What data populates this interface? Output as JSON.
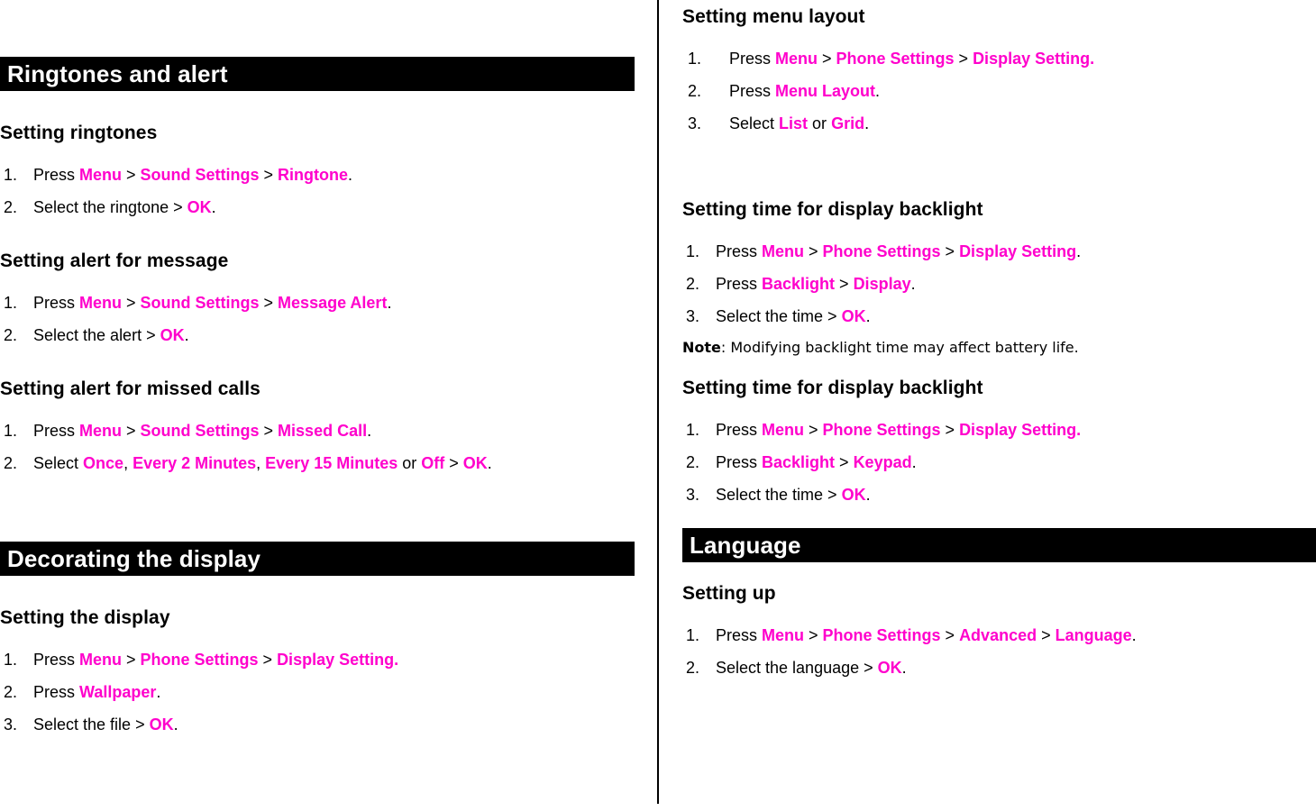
{
  "theme": {
    "accent_magenta": "#ff00cc",
    "banner_background": "#000000",
    "banner_text": "#ffffff",
    "page_background": "#ffffff",
    "body_text": "#000000"
  },
  "left_column": {
    "sections": [
      {
        "banner": "Ringtones and alert",
        "topics": [
          {
            "heading": "Setting ringtones",
            "steps": [
              {
                "num": "1.",
                "parts": [
                  {
                    "t": "Press ",
                    "k": "plain"
                  },
                  {
                    "t": "Menu",
                    "k": "mag"
                  },
                  {
                    "t": " > ",
                    "k": "plain"
                  },
                  {
                    "t": "Sound Settings",
                    "k": "mag"
                  },
                  {
                    "t": " > ",
                    "k": "plain"
                  },
                  {
                    "t": "Ringtone",
                    "k": "mag"
                  },
                  {
                    "t": ".",
                    "k": "plain"
                  }
                ]
              },
              {
                "num": "2.",
                "parts": [
                  {
                    "t": "Select the ringtone > ",
                    "k": "plain"
                  },
                  {
                    "t": "OK",
                    "k": "mag"
                  },
                  {
                    "t": ".",
                    "k": "plain"
                  }
                ]
              }
            ]
          },
          {
            "heading": "Setting alert for message",
            "steps": [
              {
                "num": "1.",
                "parts": [
                  {
                    "t": "Press ",
                    "k": "plain"
                  },
                  {
                    "t": "Menu",
                    "k": "mag"
                  },
                  {
                    "t": " > ",
                    "k": "plain"
                  },
                  {
                    "t": "Sound Settings",
                    "k": "mag"
                  },
                  {
                    "t": " > ",
                    "k": "plain"
                  },
                  {
                    "t": "Message Alert",
                    "k": "mag"
                  },
                  {
                    "t": ".",
                    "k": "plain"
                  }
                ]
              },
              {
                "num": "2.",
                "parts": [
                  {
                    "t": "Select the alert > ",
                    "k": "plain"
                  },
                  {
                    "t": "OK",
                    "k": "mag"
                  },
                  {
                    "t": ".",
                    "k": "plain"
                  }
                ]
              }
            ]
          },
          {
            "heading": "Setting alert for missed calls",
            "steps": [
              {
                "num": "1.",
                "parts": [
                  {
                    "t": "Press ",
                    "k": "plain"
                  },
                  {
                    "t": "Menu",
                    "k": "mag"
                  },
                  {
                    "t": " > ",
                    "k": "plain"
                  },
                  {
                    "t": "Sound Settings",
                    "k": "mag"
                  },
                  {
                    "t": " > ",
                    "k": "plain"
                  },
                  {
                    "t": "Missed Call",
                    "k": "mag"
                  },
                  {
                    "t": ".",
                    "k": "plain"
                  }
                ]
              },
              {
                "num": "2.",
                "parts": [
                  {
                    "t": "Select ",
                    "k": "plain"
                  },
                  {
                    "t": "Once",
                    "k": "mag"
                  },
                  {
                    "t": ", ",
                    "k": "plain"
                  },
                  {
                    "t": "Every 2 Minutes",
                    "k": "mag"
                  },
                  {
                    "t": ", ",
                    "k": "plain"
                  },
                  {
                    "t": "Every 15 Minutes",
                    "k": "mag"
                  },
                  {
                    "t": " or ",
                    "k": "plain"
                  },
                  {
                    "t": "Off",
                    "k": "mag"
                  },
                  {
                    "t": " > ",
                    "k": "plain"
                  },
                  {
                    "t": "OK",
                    "k": "mag"
                  },
                  {
                    "t": ".",
                    "k": "plain"
                  }
                ]
              }
            ]
          }
        ]
      },
      {
        "banner": "Decorating the display",
        "topics": [
          {
            "heading": "Setting the display",
            "steps": [
              {
                "num": "1.",
                "parts": [
                  {
                    "t": "Press ",
                    "k": "plain"
                  },
                  {
                    "t": "Menu",
                    "k": "mag"
                  },
                  {
                    "t": " > ",
                    "k": "plain"
                  },
                  {
                    "t": "Phone Settings",
                    "k": "mag"
                  },
                  {
                    "t": " > ",
                    "k": "plain"
                  },
                  {
                    "t": "Display Setting.",
                    "k": "mag"
                  }
                ]
              },
              {
                "num": "2.",
                "parts": [
                  {
                    "t": "Press ",
                    "k": "plain"
                  },
                  {
                    "t": "Wallpaper",
                    "k": "mag"
                  },
                  {
                    "t": ".",
                    "k": "plain"
                  }
                ]
              },
              {
                "num": "3.",
                "parts": [
                  {
                    "t": "Select the file > ",
                    "k": "plain"
                  },
                  {
                    "t": "OK",
                    "k": "mag"
                  },
                  {
                    "t": ".",
                    "k": "plain"
                  }
                ]
              }
            ]
          }
        ]
      }
    ]
  },
  "right_column": {
    "topics": [
      {
        "heading": "Setting menu layout",
        "wide_numbers": true,
        "steps": [
          {
            "num": "1.",
            "parts": [
              {
                "t": "Press ",
                "k": "plain"
              },
              {
                "t": "Menu",
                "k": "mag"
              },
              {
                "t": " > ",
                "k": "plain"
              },
              {
                "t": "Phone Settings",
                "k": "mag"
              },
              {
                "t": " > ",
                "k": "plain"
              },
              {
                "t": "Display Setting.",
                "k": "mag"
              }
            ]
          },
          {
            "num": "2.",
            "parts": [
              {
                "t": "Press ",
                "k": "plain"
              },
              {
                "t": "Menu Layout",
                "k": "mag"
              },
              {
                "t": ".",
                "k": "plain"
              }
            ]
          },
          {
            "num": "3.",
            "parts": [
              {
                "t": "Select ",
                "k": "plain"
              },
              {
                "t": "List",
                "k": "mag"
              },
              {
                "t": " or ",
                "k": "plain"
              },
              {
                "t": "Grid",
                "k": "mag"
              },
              {
                "t": ".",
                "k": "plain"
              }
            ]
          }
        ]
      },
      {
        "heading": "Setting time for display backlight",
        "wide_numbers": false,
        "steps": [
          {
            "num": "1.",
            "parts": [
              {
                "t": "Press ",
                "k": "plain"
              },
              {
                "t": "Menu",
                "k": "mag"
              },
              {
                "t": " > ",
                "k": "plain"
              },
              {
                "t": "Phone Settings",
                "k": "mag"
              },
              {
                "t": " > ",
                "k": "plain"
              },
              {
                "t": "Display Setting",
                "k": "mag"
              },
              {
                "t": ".",
                "k": "plain"
              }
            ]
          },
          {
            "num": "2.",
            "parts": [
              {
                "t": "Press ",
                "k": "plain"
              },
              {
                "t": "Backlight",
                "k": "mag"
              },
              {
                "t": " > ",
                "k": "plain"
              },
              {
                "t": "Display",
                "k": "mag"
              },
              {
                "t": ".",
                "k": "plain"
              }
            ]
          },
          {
            "num": "3.",
            "parts": [
              {
                "t": "Select the time > ",
                "k": "plain"
              },
              {
                "t": "OK",
                "k": "mag"
              },
              {
                "t": ".",
                "k": "plain"
              }
            ]
          }
        ],
        "note": {
          "label": "Note",
          "text": ": Modifying backlight time may affect battery life."
        }
      },
      {
        "heading": "Setting time for display backlight",
        "wide_numbers": false,
        "steps": [
          {
            "num": "1.",
            "parts": [
              {
                "t": "Press ",
                "k": "plain"
              },
              {
                "t": "Menu",
                "k": "mag"
              },
              {
                "t": " > ",
                "k": "plain"
              },
              {
                "t": "Phone Settings",
                "k": "mag"
              },
              {
                "t": " > ",
                "k": "plain"
              },
              {
                "t": "Display Setting.",
                "k": "mag"
              }
            ]
          },
          {
            "num": "2.",
            "parts": [
              {
                "t": "Press ",
                "k": "plain"
              },
              {
                "t": "Backlight",
                "k": "mag"
              },
              {
                "t": " > ",
                "k": "plain"
              },
              {
                "t": "Keypad",
                "k": "mag"
              },
              {
                "t": ".",
                "k": "plain"
              }
            ]
          },
          {
            "num": "3.",
            "parts": [
              {
                "t": "Select the time > ",
                "k": "plain"
              },
              {
                "t": "OK",
                "k": "mag"
              },
              {
                "t": ".",
                "k": "plain"
              }
            ]
          }
        ]
      }
    ],
    "sections": [
      {
        "banner": "Language",
        "topics": [
          {
            "heading": "Setting up",
            "wide_numbers": false,
            "steps": [
              {
                "num": "1.",
                "parts": [
                  {
                    "t": "Press ",
                    "k": "plain"
                  },
                  {
                    "t": "Menu",
                    "k": "mag"
                  },
                  {
                    "t": " > ",
                    "k": "plain"
                  },
                  {
                    "t": "Phone Settings",
                    "k": "mag"
                  },
                  {
                    "t": " > ",
                    "k": "plain"
                  },
                  {
                    "t": "Advanced",
                    "k": "mag"
                  },
                  {
                    "t": " > ",
                    "k": "plain"
                  },
                  {
                    "t": "Language",
                    "k": "mag"
                  },
                  {
                    "t": ".",
                    "k": "plain"
                  }
                ]
              },
              {
                "num": "2.",
                "parts": [
                  {
                    "t": "Select the language > ",
                    "k": "plain"
                  },
                  {
                    "t": "OK",
                    "k": "mag"
                  },
                  {
                    "t": ".",
                    "k": "plain"
                  }
                ]
              }
            ]
          }
        ]
      }
    ]
  }
}
